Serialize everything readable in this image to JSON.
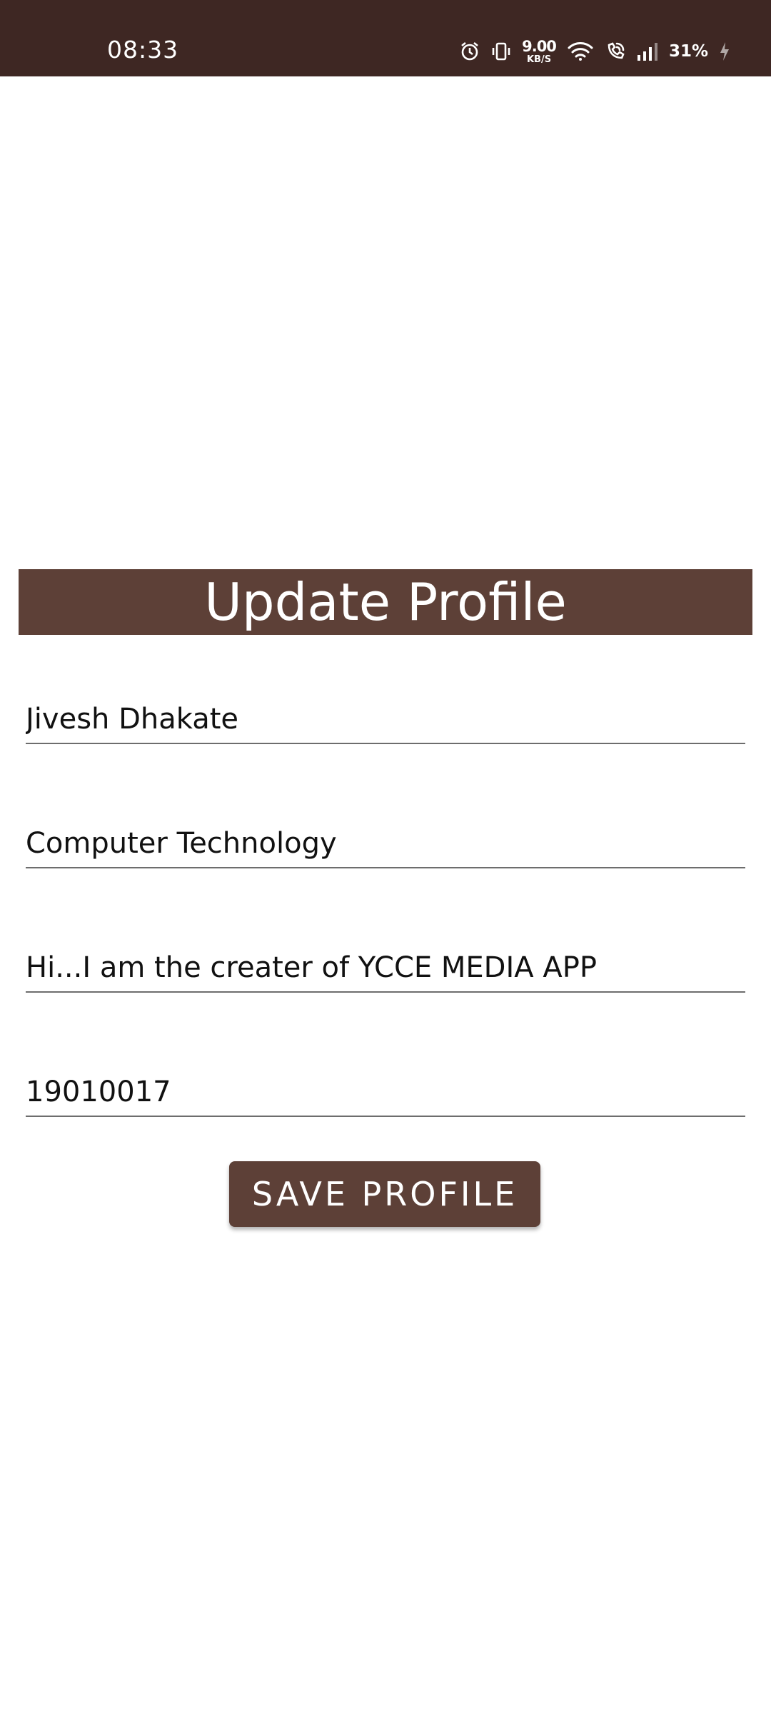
{
  "status_bar": {
    "time": "08:33",
    "net_speed_value": "9.00",
    "net_speed_unit": "KB/S",
    "battery": "31%",
    "icons": [
      "alarm-icon",
      "vibrate-icon",
      "wifi-icon",
      "wifi-call-icon",
      "signal-icon",
      "charging-icon"
    ]
  },
  "header": {
    "title": "Update Profile"
  },
  "form": {
    "name_value": "Jivesh Dhakate",
    "department_value": "Computer Technology",
    "bio_value": "Hi...I am the creater of YCCE MEDIA APP",
    "id_value": "19010017"
  },
  "actions": {
    "save_label": "SAVE PROFILE"
  },
  "colors": {
    "status_bar": "#3e2723",
    "primary": "#5d4037",
    "background": "#ffffff"
  }
}
